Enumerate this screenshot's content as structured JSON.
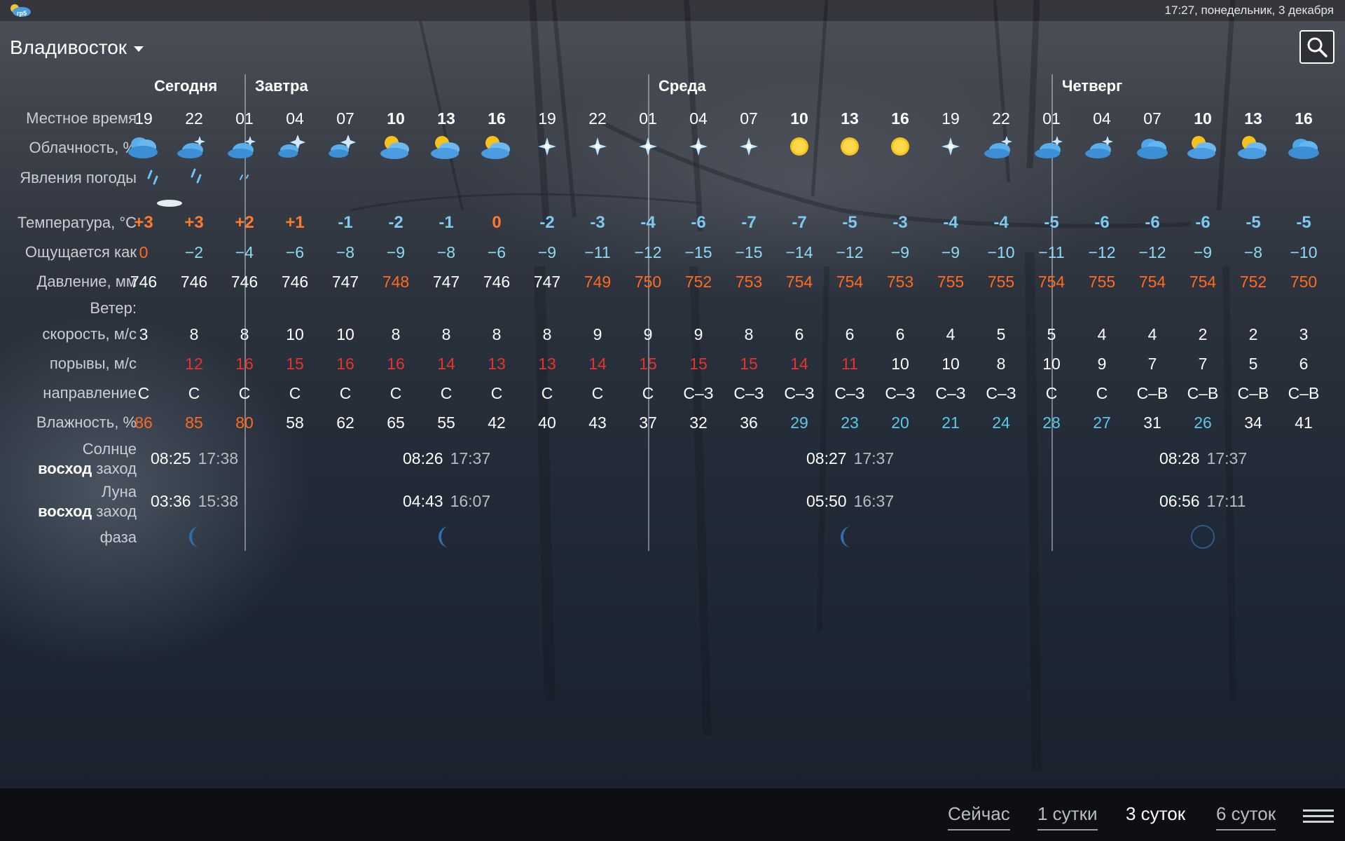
{
  "status_bar": {
    "datetime": "17:27, понедельник, 3 декабря"
  },
  "header": {
    "city": "Владивосток"
  },
  "row_labels": {
    "local_time": "Местное время",
    "cloudiness": "Облачность, %",
    "phenomena": "Явления погоды",
    "temperature": "Температура, °С",
    "feels_like": "Ощущается как",
    "pressure": "Давление, мм",
    "wind": "Ветер:",
    "wind_speed": "скорость, м/с",
    "gusts": "порывы, м/с",
    "direction": "направление",
    "humidity": "Влажность, %",
    "sun": "Солнце",
    "moon": "Луна",
    "rise": "восход",
    "set": "заход",
    "phase": "фаза"
  },
  "days": [
    {
      "label": "Сегодня"
    },
    {
      "label": "Завтра"
    },
    {
      "label": "Среда"
    },
    {
      "label": "Четверг"
    }
  ],
  "hours": [
    {
      "h": "19",
      "bold": false,
      "cloud": "cloud-rain",
      "temp": "+3",
      "tc": "warm",
      "feels": "0",
      "fc": "orange",
      "press": "746",
      "pc": "white",
      "speed": "3",
      "gust": "",
      "gc": "red",
      "dir": "С",
      "hum": "86",
      "hc": "orange"
    },
    {
      "h": "22",
      "bold": false,
      "cloud": "cloud-moon",
      "temp": "+3",
      "tc": "warm",
      "feels": "−2",
      "fc": "lblue",
      "press": "746",
      "pc": "white",
      "speed": "8",
      "gust": "12",
      "gc": "red",
      "dir": "С",
      "hum": "85",
      "hc": "orange"
    },
    {
      "h": "01",
      "bold": false,
      "cloud": "cloud-moon",
      "temp": "+2",
      "tc": "warm",
      "feels": "−4",
      "fc": "lblue",
      "press": "746",
      "pc": "white",
      "speed": "8",
      "gust": "16",
      "gc": "red",
      "dir": "С",
      "hum": "80",
      "hc": "orange"
    },
    {
      "h": "04",
      "bold": false,
      "cloud": "cloud-star",
      "temp": "+1",
      "tc": "warm",
      "feels": "−6",
      "fc": "lblue",
      "press": "746",
      "pc": "white",
      "speed": "10",
      "gust": "15",
      "gc": "red",
      "dir": "С",
      "hum": "58",
      "hc": "white"
    },
    {
      "h": "07",
      "bold": false,
      "cloud": "cloud-star",
      "temp": "-1",
      "tc": "bluecold",
      "feels": "−8",
      "fc": "lblue",
      "press": "747",
      "pc": "white",
      "speed": "10",
      "gust": "16",
      "gc": "red",
      "dir": "С",
      "hum": "62",
      "hc": "white"
    },
    {
      "h": "10",
      "bold": true,
      "cloud": "cloud-sun",
      "temp": "-2",
      "tc": "bluecold",
      "feels": "−9",
      "fc": "lblue",
      "press": "748",
      "pc": "orange",
      "speed": "8",
      "gust": "16",
      "gc": "red",
      "dir": "С",
      "hum": "65",
      "hc": "white"
    },
    {
      "h": "13",
      "bold": true,
      "cloud": "cloud-sun",
      "temp": "-1",
      "tc": "bluecold",
      "feels": "−8",
      "fc": "lblue",
      "press": "747",
      "pc": "white",
      "speed": "8",
      "gust": "14",
      "gc": "red",
      "dir": "С",
      "hum": "55",
      "hc": "white"
    },
    {
      "h": "16",
      "bold": true,
      "cloud": "cloud-sun",
      "temp": "0",
      "tc": "warm",
      "feels": "−6",
      "fc": "lblue",
      "press": "746",
      "pc": "white",
      "speed": "8",
      "gust": "13",
      "gc": "red",
      "dir": "С",
      "hum": "42",
      "hc": "white"
    },
    {
      "h": "19",
      "bold": false,
      "cloud": "star",
      "temp": "-2",
      "tc": "bluecold",
      "feels": "−9",
      "fc": "lblue",
      "press": "747",
      "pc": "white",
      "speed": "8",
      "gust": "13",
      "gc": "red",
      "dir": "С",
      "hum": "40",
      "hc": "white"
    },
    {
      "h": "22",
      "bold": false,
      "cloud": "star",
      "temp": "-3",
      "tc": "bluecold",
      "feels": "−11",
      "fc": "lblue",
      "press": "749",
      "pc": "orange",
      "speed": "9",
      "gust": "14",
      "gc": "red",
      "dir": "С",
      "hum": "43",
      "hc": "white"
    },
    {
      "h": "01",
      "bold": false,
      "cloud": "star",
      "temp": "-4",
      "tc": "bluecold",
      "feels": "−12",
      "fc": "lblue",
      "press": "750",
      "pc": "orange",
      "speed": "9",
      "gust": "15",
      "gc": "red",
      "dir": "С",
      "hum": "37",
      "hc": "white"
    },
    {
      "h": "04",
      "bold": false,
      "cloud": "star",
      "temp": "-6",
      "tc": "bluecold",
      "feels": "−15",
      "fc": "lblue",
      "press": "752",
      "pc": "orange",
      "speed": "9",
      "gust": "15",
      "gc": "red",
      "dir": "С–З",
      "hum": "32",
      "hc": "white"
    },
    {
      "h": "07",
      "bold": false,
      "cloud": "star",
      "temp": "-7",
      "tc": "bluecold",
      "feels": "−15",
      "fc": "lblue",
      "press": "753",
      "pc": "orange",
      "speed": "8",
      "gust": "15",
      "gc": "red",
      "dir": "С–З",
      "hum": "36",
      "hc": "white"
    },
    {
      "h": "10",
      "bold": true,
      "cloud": "sun",
      "temp": "-7",
      "tc": "bluecold",
      "feels": "−14",
      "fc": "lblue",
      "press": "754",
      "pc": "orange",
      "speed": "6",
      "gust": "14",
      "gc": "red",
      "dir": "С–З",
      "hum": "29",
      "hc": "blue"
    },
    {
      "h": "13",
      "bold": true,
      "cloud": "sun",
      "temp": "-5",
      "tc": "bluecold",
      "feels": "−12",
      "fc": "lblue",
      "press": "754",
      "pc": "orange",
      "speed": "6",
      "gust": "11",
      "gc": "red",
      "dir": "С–З",
      "hum": "23",
      "hc": "blue"
    },
    {
      "h": "16",
      "bold": true,
      "cloud": "sun",
      "temp": "-3",
      "tc": "bluecold",
      "feels": "−9",
      "fc": "lblue",
      "press": "753",
      "pc": "orange",
      "speed": "6",
      "gust": "10",
      "gc": "white",
      "dir": "С–З",
      "hum": "20",
      "hc": "blue"
    },
    {
      "h": "19",
      "bold": false,
      "cloud": "star",
      "temp": "-4",
      "tc": "bluecold",
      "feels": "−9",
      "fc": "lblue",
      "press": "755",
      "pc": "orange",
      "speed": "4",
      "gust": "10",
      "gc": "white",
      "dir": "С–З",
      "hum": "21",
      "hc": "blue"
    },
    {
      "h": "22",
      "bold": false,
      "cloud": "cloud-moon",
      "temp": "-4",
      "tc": "bluecold",
      "feels": "−10",
      "fc": "lblue",
      "press": "755",
      "pc": "orange",
      "speed": "5",
      "gust": "8",
      "gc": "white",
      "dir": "С–З",
      "hum": "24",
      "hc": "blue"
    },
    {
      "h": "01",
      "bold": false,
      "cloud": "cloud-moon",
      "temp": "-5",
      "tc": "bluecold",
      "feels": "−11",
      "fc": "lblue",
      "press": "754",
      "pc": "orange",
      "speed": "5",
      "gust": "10",
      "gc": "white",
      "dir": "С",
      "hum": "28",
      "hc": "blue"
    },
    {
      "h": "04",
      "bold": false,
      "cloud": "cloud-moon",
      "temp": "-6",
      "tc": "bluecold",
      "feels": "−12",
      "fc": "lblue",
      "press": "755",
      "pc": "orange",
      "speed": "4",
      "gust": "9",
      "gc": "white",
      "dir": "С",
      "hum": "27",
      "hc": "blue"
    },
    {
      "h": "07",
      "bold": false,
      "cloud": "cloud",
      "temp": "-6",
      "tc": "bluecold",
      "feels": "−12",
      "fc": "lblue",
      "press": "754",
      "pc": "orange",
      "speed": "4",
      "gust": "7",
      "gc": "white",
      "dir": "С–В",
      "hum": "31",
      "hc": "white"
    },
    {
      "h": "10",
      "bold": true,
      "cloud": "cloud-sun",
      "temp": "-6",
      "tc": "bluecold",
      "feels": "−9",
      "fc": "lblue",
      "press": "754",
      "pc": "orange",
      "speed": "2",
      "gust": "7",
      "gc": "white",
      "dir": "С–В",
      "hum": "26",
      "hc": "blue"
    },
    {
      "h": "13",
      "bold": true,
      "cloud": "cloud-sun",
      "temp": "-5",
      "tc": "bluecold",
      "feels": "−8",
      "fc": "lblue",
      "press": "752",
      "pc": "orange",
      "speed": "2",
      "gust": "5",
      "gc": "white",
      "dir": "С–В",
      "hum": "34",
      "hc": "white"
    },
    {
      "h": "16",
      "bold": true,
      "cloud": "cloud",
      "temp": "-5",
      "tc": "bluecold",
      "feels": "−10",
      "fc": "lblue",
      "press": "750",
      "pc": "orange",
      "speed": "3",
      "gust": "6",
      "gc": "white",
      "dir": "С–В",
      "hum": "41",
      "hc": "white"
    }
  ],
  "astro": [
    {
      "sunrise": "08:25",
      "sunset": "17:38",
      "moonrise": "03:36",
      "moonset": "15:38",
      "phase": "crescent"
    },
    {
      "sunrise": "08:26",
      "sunset": "17:37",
      "moonrise": "04:43",
      "moonset": "16:07",
      "phase": "crescent"
    },
    {
      "sunrise": "08:27",
      "sunset": "17:37",
      "moonrise": "05:50",
      "moonset": "16:37",
      "phase": "crescent"
    },
    {
      "sunrise": "08:28",
      "sunset": "17:37",
      "moonrise": "06:56",
      "moonset": "17:11",
      "phase": "new-moon"
    }
  ],
  "tabs": [
    {
      "label": "Сейчас",
      "active": false
    },
    {
      "label": "1 сутки",
      "active": false
    },
    {
      "label": "3 суток",
      "active": true
    },
    {
      "label": "6 суток",
      "active": false
    }
  ],
  "icons": {
    "app": "gismeteo-app-icon",
    "search": "search-icon",
    "menu": "menu-icon",
    "city_dropdown": "chevron-down-icon"
  }
}
